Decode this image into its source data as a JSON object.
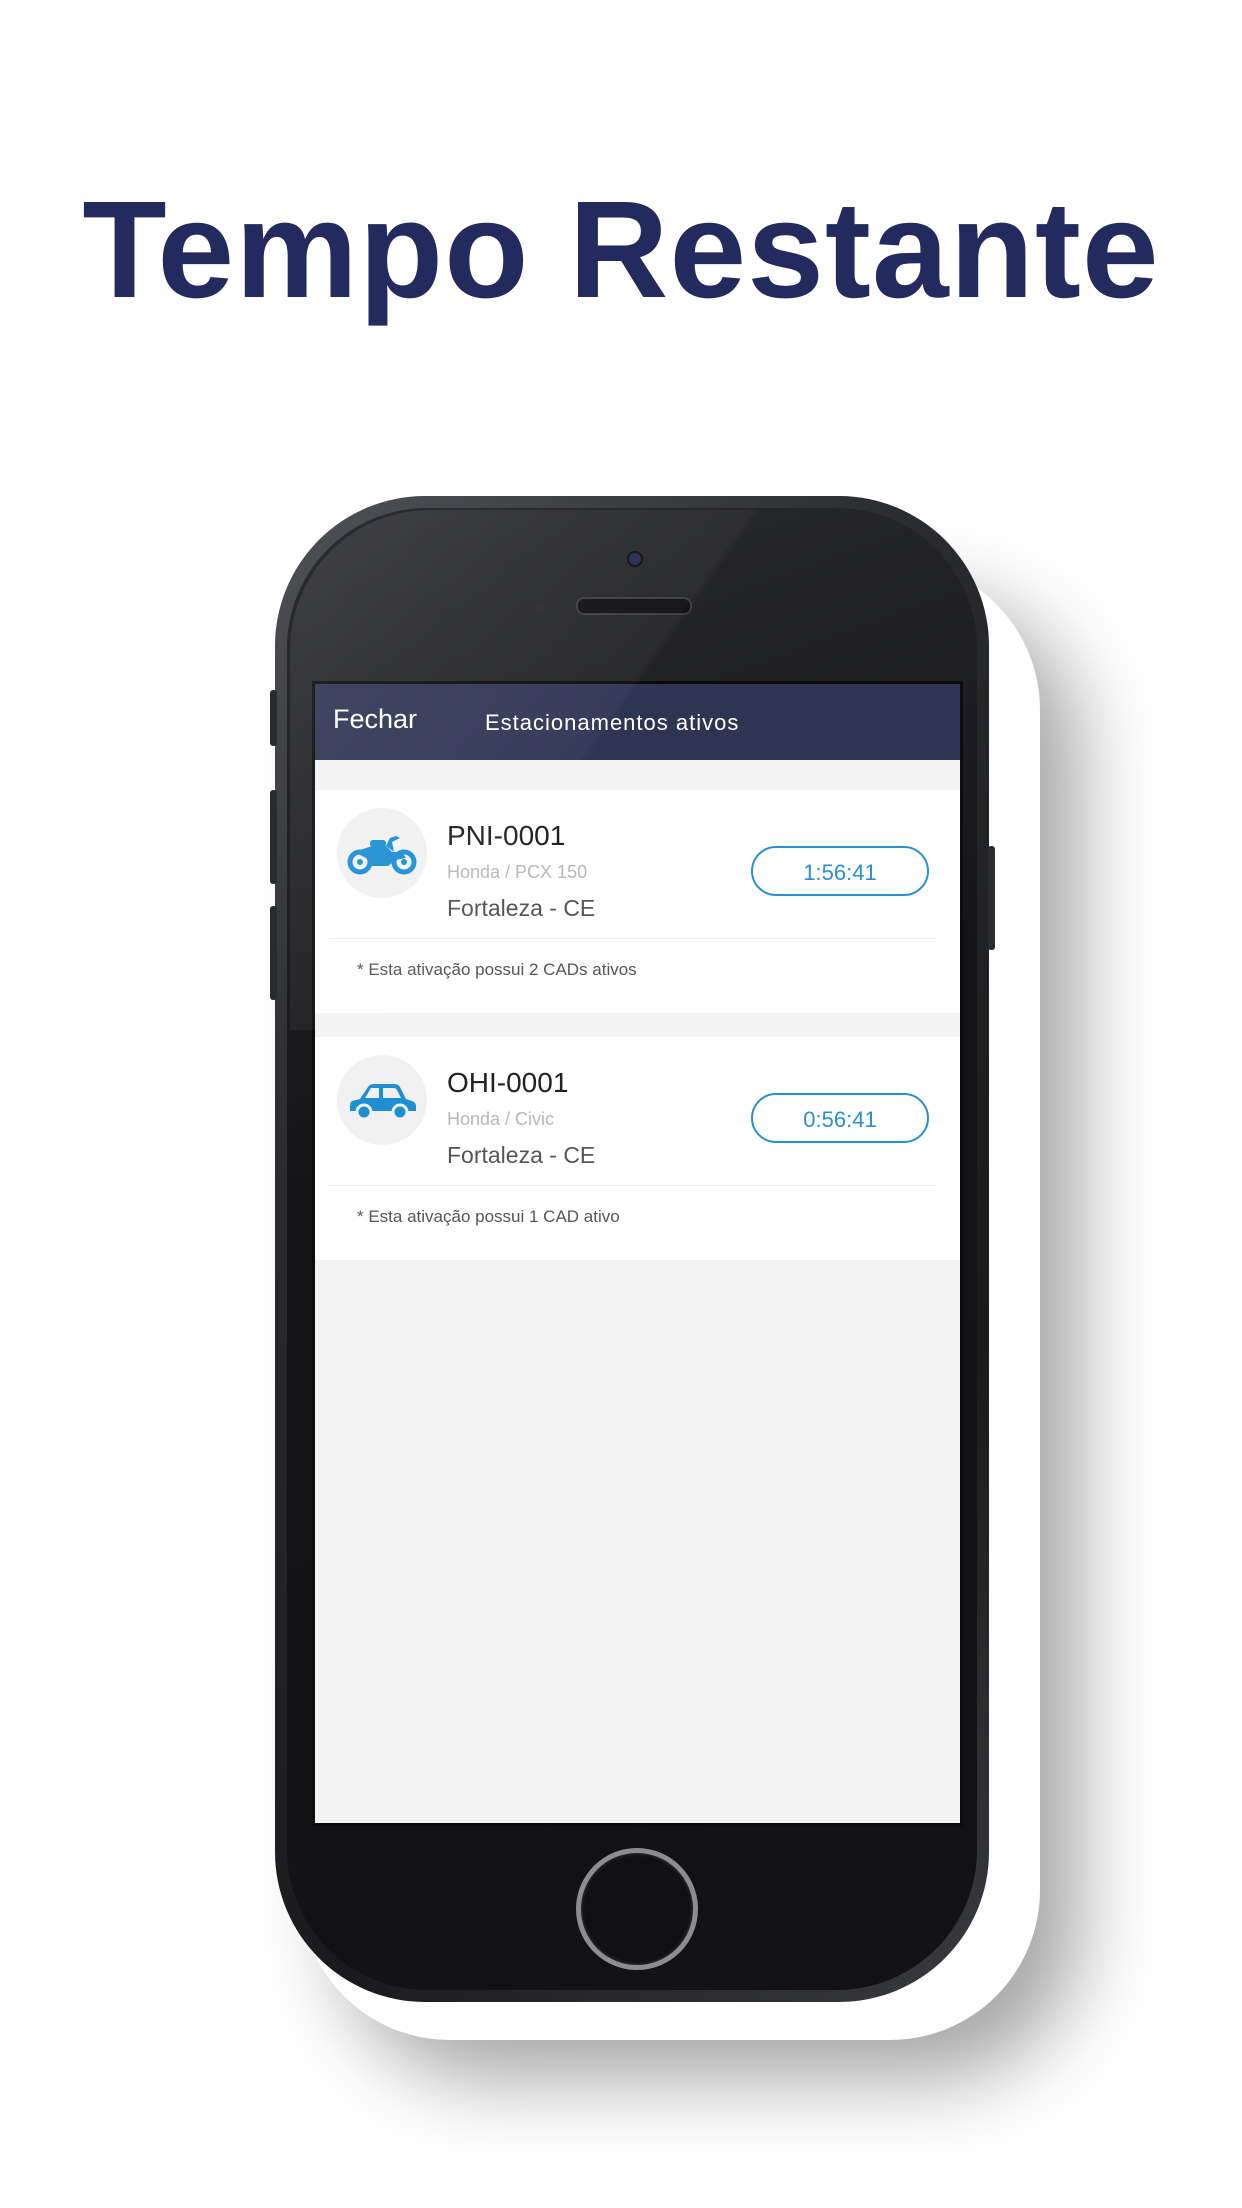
{
  "headline": "Tempo Restante",
  "navbar": {
    "close_label": "Fechar",
    "title": "Estacionamentos ativos"
  },
  "parkings": [
    {
      "plate": "PNI-0001",
      "model": "Honda / PCX 150",
      "city": "Fortaleza - CE",
      "time_remaining": "1:56:41",
      "note": "* Esta ativação possui 2 CADs ativos",
      "icon": "motorcycle-icon"
    },
    {
      "plate": "OHI-0001",
      "model": "Honda / Civic",
      "city": "Fortaleza - CE",
      "time_remaining": "0:56:41",
      "note": "* Esta ativação possui 1 CAD ativo",
      "icon": "car-icon"
    }
  ],
  "colors": {
    "headline": "#232a5e",
    "navbar": "#2e3553",
    "accent": "#2a8fd0",
    "screen_background": "#f3f3f3"
  }
}
